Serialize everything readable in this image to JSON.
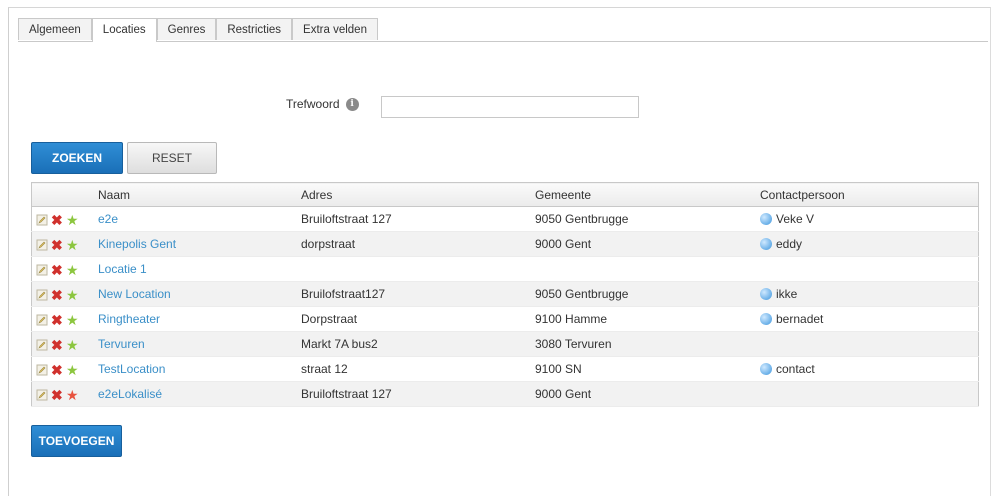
{
  "tabs": [
    {
      "label": "Algemeen",
      "active": false
    },
    {
      "label": "Locaties",
      "active": true
    },
    {
      "label": "Genres",
      "active": false
    },
    {
      "label": "Restricties",
      "active": false
    },
    {
      "label": "Extra velden",
      "active": false
    }
  ],
  "search": {
    "keyword_label": "Trefwoord",
    "keyword_value": "",
    "search_label": "ZOEKEN",
    "reset_label": "RESET"
  },
  "table": {
    "headers": {
      "naam": "Naam",
      "adres": "Adres",
      "gemeente": "Gemeente",
      "contact": "Contactpersoon"
    },
    "rows": [
      {
        "naam": "e2e",
        "adres": "Bruiloftstraat 127",
        "gemeente": "9050 Gentbrugge",
        "contact": "Veke V",
        "star": "green"
      },
      {
        "naam": "Kinepolis Gent",
        "adres": "dorpstraat",
        "gemeente": "9000 Gent",
        "contact": "eddy",
        "star": "green"
      },
      {
        "naam": "Locatie 1",
        "adres": "",
        "gemeente": "",
        "contact": "",
        "star": "green"
      },
      {
        "naam": "New Location",
        "adres": "Bruilofstraat127",
        "gemeente": "9050 Gentbrugge",
        "contact": "ikke",
        "star": "green"
      },
      {
        "naam": "Ringtheater",
        "adres": "Dorpstraat",
        "gemeente": "9100 Hamme",
        "contact": "bernadet",
        "star": "green"
      },
      {
        "naam": "Tervuren",
        "adres": "Markt 7A bus2",
        "gemeente": "3080 Tervuren",
        "contact": "",
        "star": "green"
      },
      {
        "naam": "TestLocation",
        "adres": "straat 12",
        "gemeente": "9100 SN",
        "contact": "contact",
        "star": "green"
      },
      {
        "naam": "e2eLokalisé",
        "adres": "Bruiloftstraat 127",
        "gemeente": "9000 Gent",
        "contact": "",
        "star": "red"
      }
    ]
  },
  "add_label": "TOEVOEGEN",
  "colors": {
    "accent": "#1a6fb8",
    "link": "#3a8fc8",
    "delete": "#d0312d",
    "star_green": "#8cc63f",
    "star_red": "#e8533f"
  },
  "icons": {
    "edit": "pencil-icon",
    "delete": "delete-x-icon",
    "star": "star-icon",
    "info": "info-icon"
  }
}
